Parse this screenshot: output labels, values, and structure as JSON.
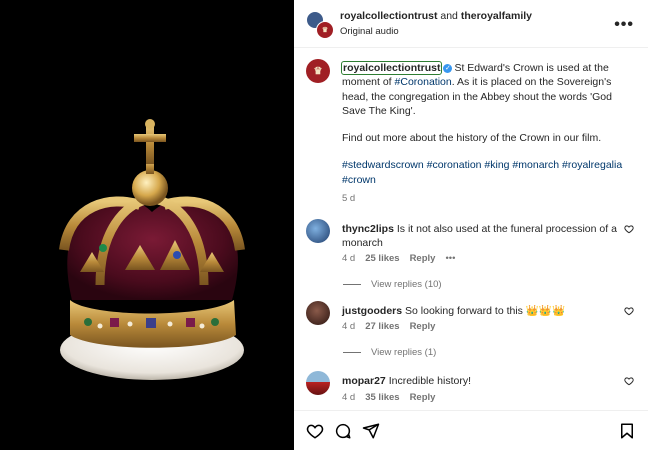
{
  "header": {
    "user1": "royalcollectiontrust",
    "joiner": "and",
    "user2": "theroyalfamily",
    "audio": "Original audio"
  },
  "caption": {
    "username": "royalcollectiontrust",
    "text1": "St Edward's Crown is used at the moment of",
    "tag_coronation": "#Coronation",
    "text2": ". As it is placed on the Sovereign's head, the congregation in the Abbey shout the words 'God Save The King'.",
    "para2": "Find out more about the history of the Crown in our film.",
    "hashtags": "#stedwardscrown #coronation #king #monarch #royalregalia #crown",
    "age": "5 d"
  },
  "comments": [
    {
      "username": "thync2lips",
      "text": "Is it not also used at the funeral procession of a monarch",
      "age": "4 d",
      "likes": "25 likes",
      "reply": "Reply",
      "more": "•••",
      "view_replies": "View replies (10)"
    },
    {
      "username": "justgooders",
      "text": "So looking forward to this 👑👑👑",
      "age": "4 d",
      "likes": "27 likes",
      "reply": "Reply",
      "view_replies": "View replies (1)"
    },
    {
      "username": "mopar27",
      "text": "Incredible history!",
      "age": "4 d",
      "likes": "35 likes",
      "reply": "Reply"
    }
  ],
  "icons": {
    "header_more": "more-horizontal-icon",
    "like": "heart-icon",
    "comment": "comment-icon",
    "share": "send-icon",
    "save": "bookmark-icon"
  },
  "colors": {
    "link": "#00376b",
    "brand_red": "#a01f24",
    "verified": "#3897f0"
  }
}
